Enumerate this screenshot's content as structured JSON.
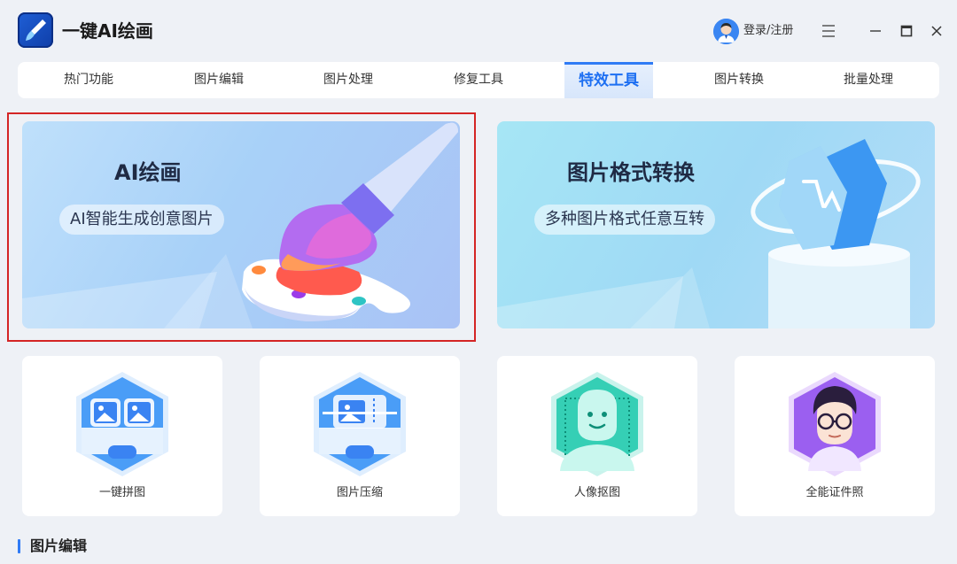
{
  "app": {
    "title": "一键AI绘画"
  },
  "header": {
    "login_label": "登录/注册"
  },
  "tabs": [
    {
      "label": "热门功能",
      "active": false
    },
    {
      "label": "图片编辑",
      "active": false
    },
    {
      "label": "图片处理",
      "active": false
    },
    {
      "label": "修复工具",
      "active": false
    },
    {
      "label": "特效工具",
      "active": true
    },
    {
      "label": "图片转换",
      "active": false
    },
    {
      "label": "批量处理",
      "active": false
    }
  ],
  "banners": {
    "ai": {
      "title": "AI绘画",
      "subtitle": "AI智能生成创意图片"
    },
    "convert": {
      "title": "图片格式转换",
      "subtitle": "多种图片格式任意互转"
    }
  },
  "cards": [
    {
      "label": "一键拼图",
      "icon": "collage-icon"
    },
    {
      "label": "图片压缩",
      "icon": "compress-icon"
    },
    {
      "label": "人像抠图",
      "icon": "portrait-cutout-icon"
    },
    {
      "label": "全能证件照",
      "icon": "id-photo-icon"
    }
  ],
  "section": {
    "title": "图片编辑"
  },
  "colors": {
    "accent": "#2f7bf5",
    "highlight": "#d42525",
    "background": "#eef1f6"
  }
}
